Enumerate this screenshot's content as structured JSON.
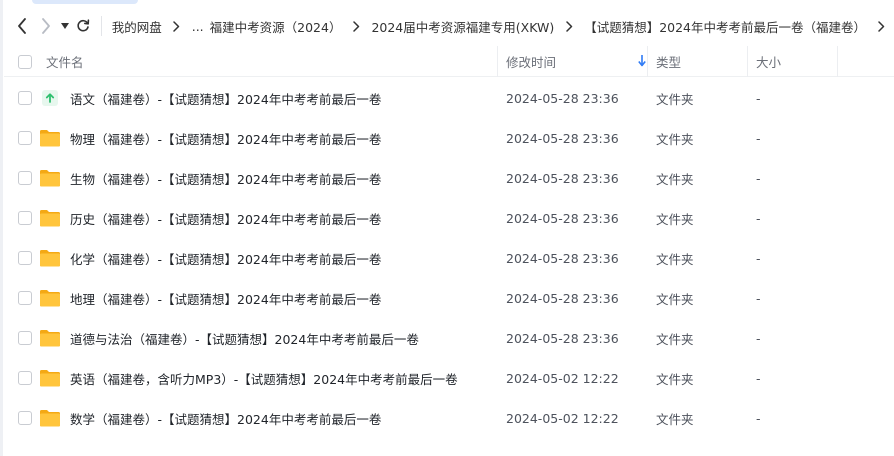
{
  "navigation": {
    "breadcrumb": [
      {
        "label": "我的网盘"
      },
      {
        "label": "..."
      },
      {
        "label": "福建中考资源（2024）"
      },
      {
        "label": "2024届中考资源福建专用(XKW)"
      },
      {
        "label": "【试题猜想】2024年中考考前最后一卷（福建卷）"
      }
    ]
  },
  "table": {
    "columns": {
      "name": "文件名",
      "modified": "修改时间",
      "type": "类型",
      "size": "大小"
    },
    "sort_indicator_icon": "arrow-down-icon",
    "rows": [
      {
        "icon": "upload-icon",
        "name": "语文（福建卷）-【试题猜想】2024年中考考前最后一卷",
        "modified": "2024-05-28 23:36",
        "type": "文件夹",
        "size": "-"
      },
      {
        "icon": "folder-icon",
        "name": "物理（福建卷）-【试题猜想】2024年中考考前最后一卷",
        "modified": "2024-05-28 23:36",
        "type": "文件夹",
        "size": "-"
      },
      {
        "icon": "folder-icon",
        "name": "生物（福建卷）-【试题猜想】2024年中考考前最后一卷",
        "modified": "2024-05-28 23:36",
        "type": "文件夹",
        "size": "-"
      },
      {
        "icon": "folder-icon",
        "name": "历史（福建卷）-【试题猜想】2024年中考考前最后一卷",
        "modified": "2024-05-28 23:36",
        "type": "文件夹",
        "size": "-"
      },
      {
        "icon": "folder-icon",
        "name": "化学（福建卷）-【试题猜想】2024年中考考前最后一卷",
        "modified": "2024-05-28 23:36",
        "type": "文件夹",
        "size": "-"
      },
      {
        "icon": "folder-icon",
        "name": "地理（福建卷）-【试题猜想】2024年中考考前最后一卷",
        "modified": "2024-05-28 23:36",
        "type": "文件夹",
        "size": "-"
      },
      {
        "icon": "folder-icon",
        "name": "道德与法治（福建卷）-【试题猜想】2024年中考考前最后一卷",
        "modified": "2024-05-28 23:36",
        "type": "文件夹",
        "size": "-"
      },
      {
        "icon": "folder-icon",
        "name": "英语（福建卷，含听力MP3）-【试题猜想】2024年中考考前最后一卷",
        "modified": "2024-05-02 12:22",
        "type": "文件夹",
        "size": "-"
      },
      {
        "icon": "folder-icon",
        "name": "数学（福建卷）-【试题猜想】2024年中考考前最后一卷",
        "modified": "2024-05-02 12:22",
        "type": "文件夹",
        "size": "-"
      }
    ]
  },
  "colors": {
    "folder": "#ffc53d",
    "folder_dark": "#f4a915",
    "upload_bg": "#e7f7ee",
    "upload_arrow": "#2ebf6e",
    "sort_arrow": "#2f7bf5"
  }
}
